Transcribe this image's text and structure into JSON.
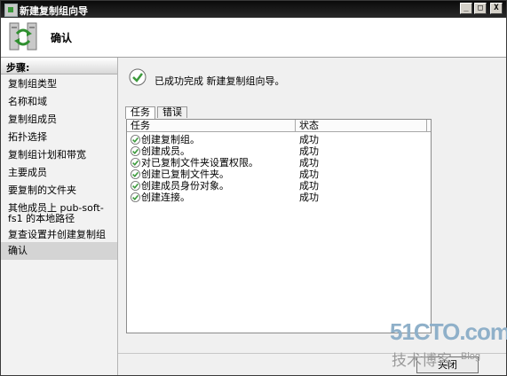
{
  "window": {
    "title": "新建复制组向导",
    "controls": {
      "minimize": "_",
      "maximize": "□",
      "close": "X"
    }
  },
  "header": {
    "title": "确认",
    "icon": "replication-group-icon"
  },
  "sidebar": {
    "heading": "步骤:",
    "items": [
      {
        "label": "复制组类型"
      },
      {
        "label": "名称和域"
      },
      {
        "label": "复制组成员"
      },
      {
        "label": "拓扑选择"
      },
      {
        "label": "复制组计划和带宽"
      },
      {
        "label": "主要成员"
      },
      {
        "label": "要复制的文件夹"
      },
      {
        "label": "其他成员上 pub-soft-fs1 的本地路径"
      },
      {
        "label": "复查设置并创建复制组"
      },
      {
        "label": "确认",
        "selected": true
      }
    ]
  },
  "main": {
    "message": "已成功完成 新建复制组向导。",
    "tabs": [
      {
        "label": "任务",
        "active": true
      },
      {
        "label": "错误",
        "active": false
      }
    ],
    "table": {
      "columns": [
        "任务",
        "状态"
      ],
      "rows": [
        {
          "task": "创建复制组。",
          "status": "成功"
        },
        {
          "task": "创建成员。",
          "status": "成功"
        },
        {
          "task": "对已复制文件夹设置权限。",
          "status": "成功"
        },
        {
          "task": "创建已复制文件夹。",
          "status": "成功"
        },
        {
          "task": "创建成员身份对象。",
          "status": "成功"
        },
        {
          "task": "创建连接。",
          "status": "成功"
        }
      ]
    }
  },
  "footer": {
    "close_label": "关闭"
  },
  "watermark": {
    "brand": "51CTO.com",
    "sub": "技术博客",
    "blog": "Blog"
  },
  "colors": {
    "success_green": "#3c9a3c",
    "selected_nav": "#d4d4d4",
    "titlebar": "#1a1a1a"
  }
}
